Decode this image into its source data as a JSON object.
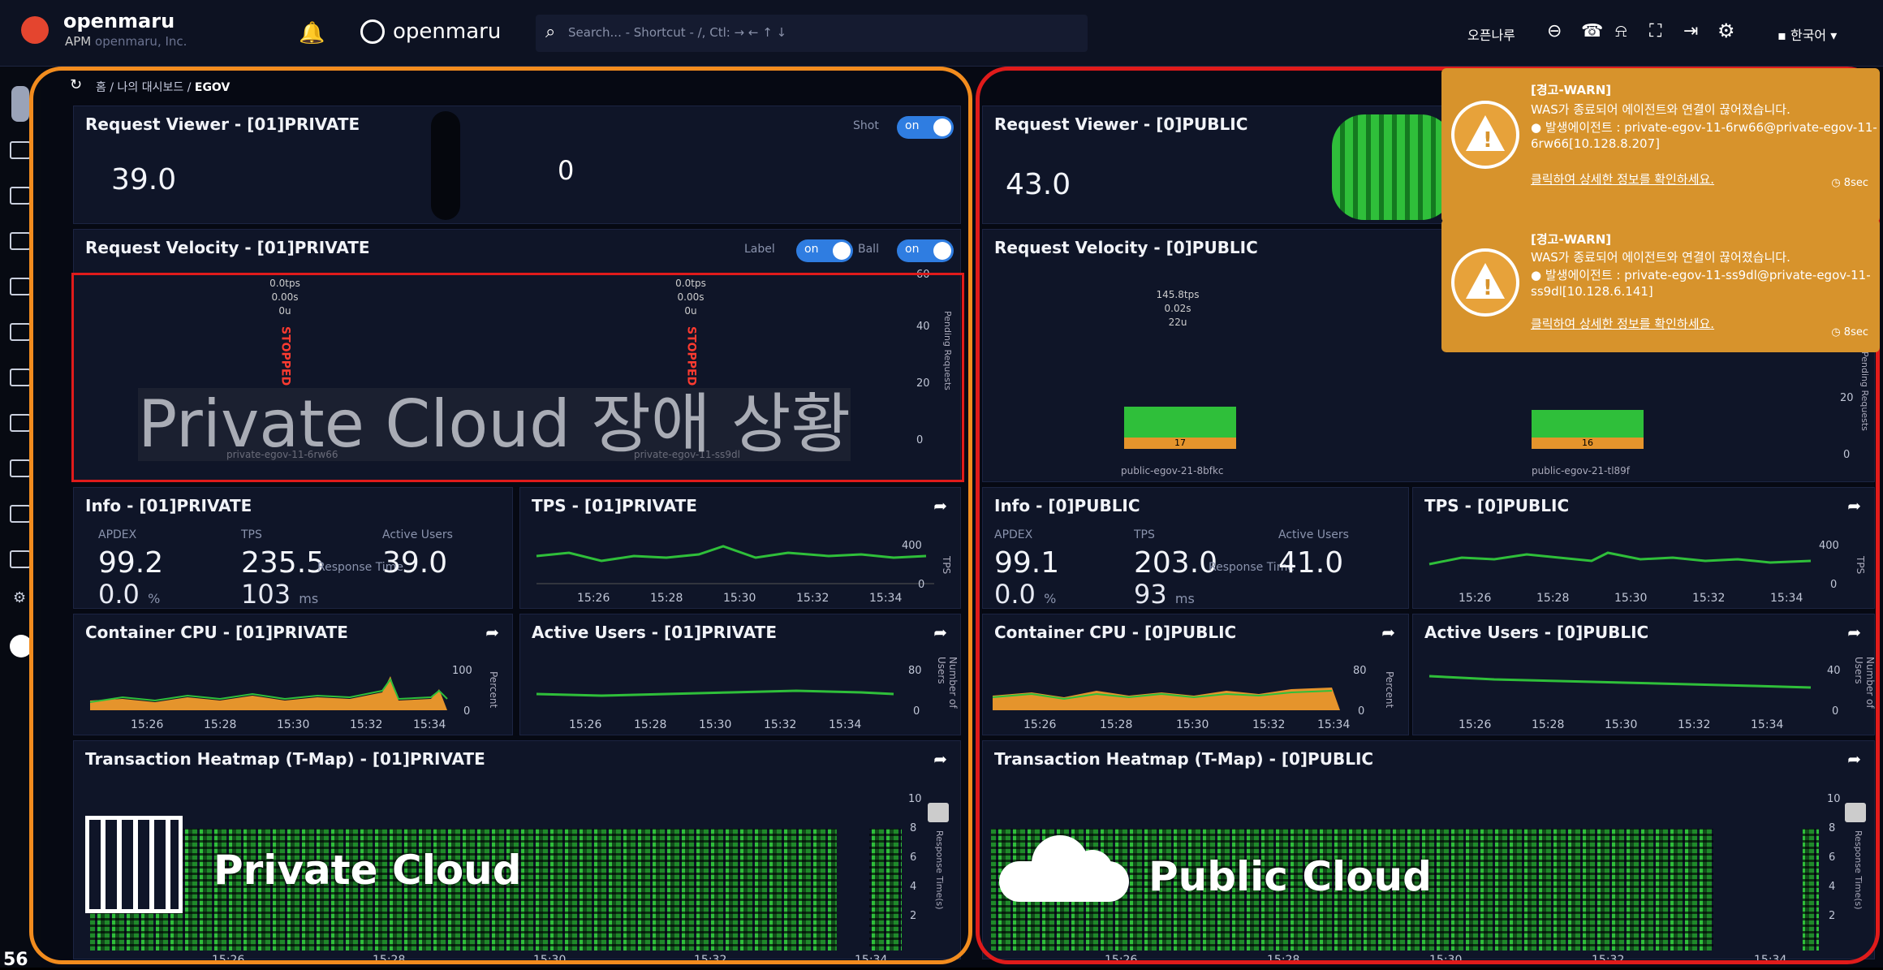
{
  "app": {
    "brand": "openmaru",
    "sub": "APM",
    "sub2": "openmaru, Inc.",
    "center_brand": "openmaru",
    "search_placeholder": "Search... - Shortcut - /, Ctl: → ← ↑ ↓",
    "user": "오픈나루",
    "lang": "한국어"
  },
  "breadcrumb": [
    "홈",
    "나의 대시보드",
    "EGOV"
  ],
  "page_number": "56",
  "private": {
    "viewer_title": "Request Viewer - [01]PRIVATE",
    "viewer_value": "39.0",
    "viewer_center": "0",
    "shot_label": "Shot",
    "toggle_on": "on",
    "velocity_title": "Request Velocity - [01]PRIVATE",
    "label_label": "Label",
    "ball_label": "Ball",
    "vel_cols": [
      {
        "tps": "0.0tps",
        "s": "0.00s",
        "u": "0u",
        "status": "STOPPED",
        "name": "private-egov-11-6rw66"
      },
      {
        "tps": "0.0tps",
        "s": "0.00s",
        "u": "0u",
        "status": "STOPPED",
        "name": "private-egov-11-ss9dl"
      }
    ],
    "vel_axis": [
      "60",
      "40",
      "20",
      "0"
    ],
    "vel_axis_label": "Pending Requests",
    "overlay_text": "Private Cloud 장애 상황",
    "info_title": "Info - [01]PRIVATE",
    "info": {
      "apdex_label": "APDEX",
      "apdex": "99.2",
      "tps_label": "TPS",
      "tps": "235.5",
      "users_label": "Active Users",
      "users": "39.0",
      "err": "0.0",
      "pct": "%",
      "rt_label": "Response Time",
      "rt": "103",
      "ms": "ms"
    },
    "tps_title": "TPS - [01]PRIVATE",
    "tps_axis": [
      "400",
      "0"
    ],
    "tps_axis_label": "TPS",
    "cpu_title": "Container CPU - [01]PRIVATE",
    "cpu_axis": [
      "100",
      "0"
    ],
    "cpu_axis_label": "Percent",
    "au_title": "Active Users - [01]PRIVATE",
    "au_axis": [
      "80",
      "0"
    ],
    "au_axis_label": "Number of Users",
    "heat_title": "Transaction Heatmap (T-Map) - [01]PRIVATE",
    "heat_axis": [
      "10",
      "8",
      "6",
      "4",
      "2"
    ],
    "heat_axis_label": "Response Time(s)",
    "times": [
      "15:26",
      "15:28",
      "15:30",
      "15:32",
      "15:34"
    ],
    "label": "Private Cloud"
  },
  "public": {
    "viewer_title": "Request Viewer - [0]PUBLIC",
    "viewer_value": "43.0",
    "velocity_title": "Request Velocity - [0]PUBLIC",
    "vel_col": {
      "tps": "145.8tps",
      "s": "0.02s",
      "u": "22u"
    },
    "bars": [
      {
        "value": "17",
        "name": "public-egov-21-8bfkc"
      },
      {
        "value": "16",
        "name": "public-egov-21-tl89f"
      }
    ],
    "vel_axis": [
      "20",
      "0"
    ],
    "vel_axis_label": "Pending Requests",
    "info_title": "Info - [0]PUBLIC",
    "info": {
      "apdex_label": "APDEX",
      "apdex": "99.1",
      "tps_label": "TPS",
      "tps": "203.0",
      "users_label": "Active Users",
      "users": "41.0",
      "err": "0.0",
      "pct": "%",
      "rt_label": "Response Time",
      "rt": "93",
      "ms": "ms"
    },
    "tps_title": "TPS - [0]PUBLIC",
    "tps_axis": [
      "400",
      "0"
    ],
    "tps_axis_label": "TPS",
    "cpu_title": "Container CPU - [0]PUBLIC",
    "cpu_axis": [
      "80",
      "0"
    ],
    "cpu_axis_label": "Percent",
    "au_title": "Active Users - [0]PUBLIC",
    "au_axis": [
      "40",
      "0"
    ],
    "au_axis_label": "Number of Users",
    "heat_title": "Transaction Heatmap (T-Map) - [0]PUBLIC",
    "heat_axis": [
      "10",
      "8",
      "6",
      "4",
      "2"
    ],
    "heat_axis_label": "Response Time(s)",
    "times": [
      "15:26",
      "15:28",
      "15:30",
      "15:32",
      "15:34"
    ],
    "label": "Public Cloud"
  },
  "toasts": [
    {
      "title": "[경고-WARN]",
      "line1": "WAS가 종료되어 에이전트와 연결이 끊어졌습니다.",
      "line2": "● 발생에이전트 : private-egov-11-6rw66@private-egov-11-",
      "line3": "6rw66[10.128.8.207]",
      "link": "클릭하여 상세한 정보를 확인하세요.",
      "time": "8sec"
    },
    {
      "title": "[경고-WARN]",
      "line1": "WAS가 종료되어 에이전트와 연결이 끊어졌습니다.",
      "line2": "● 발생에이전트 : private-egov-11-ss9dl@private-egov-11-",
      "line3": "ss9dl[10.128.6.141]",
      "link": "클릭하여 상세한 정보를 확인하세요.",
      "time": "8sec"
    }
  ],
  "colors": {
    "private_frame": "#f28c1e",
    "public_frame": "#e01b1b",
    "accent": "#2f7de1",
    "green": "#2fbf3a",
    "orange": "#e5942c"
  }
}
